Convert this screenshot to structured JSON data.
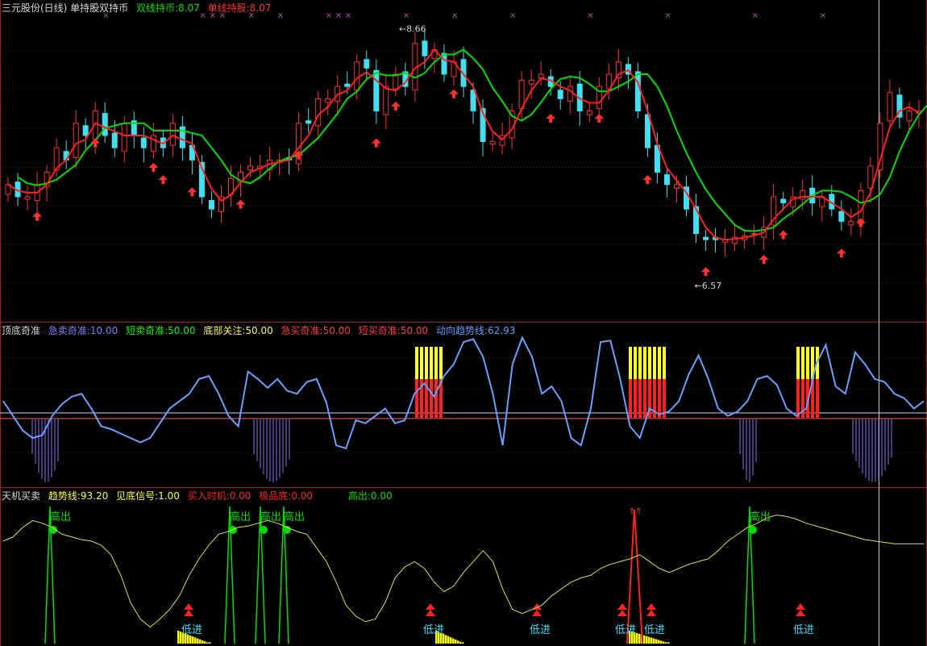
{
  "panels": {
    "top": {
      "title": "三元股份(日线) 单持股双持币",
      "legend": [
        {
          "label": "双线持币:8.07",
          "color": "#00e000"
        },
        {
          "label": "单线持股:8.07",
          "color": "#ff2020"
        }
      ],
      "high_label": "8.66",
      "low_label": "6.57"
    },
    "mid": {
      "title": "顶底奇准",
      "legend": [
        {
          "label": "急卖奇准:10.00",
          "color": "#8080ff"
        },
        {
          "label": "短卖奇准:50.00",
          "color": "#00ff00"
        },
        {
          "label": "底部关注:50.00",
          "color": "#ffff00"
        },
        {
          "label": "急买奇准:50.00",
          "color": "#ff4040"
        },
        {
          "label": "短买奇准:50.00",
          "color": "#ff4040"
        },
        {
          "label": "动向趋势线:62.93",
          "color": "#60a0ff"
        }
      ]
    },
    "bottom": {
      "title": "天机买卖",
      "legend": [
        {
          "label": "趋势线:93.20",
          "color": "#ffff00"
        },
        {
          "label": "见底信号:1.00",
          "color": "#ffff00"
        },
        {
          "label": "买入时机:0.00",
          "color": "#ff2020"
        },
        {
          "label": "极品底:0.00",
          "color": "#ff2020"
        },
        {
          "label": "高出:0.00",
          "color": "#00e000"
        }
      ],
      "buy_text": "低进",
      "sell_text": "高出"
    }
  },
  "chart_data": [
    {
      "type": "candlestick",
      "title": "三元股份(日线)",
      "close": [
        7.4,
        7.3,
        7.3,
        7.4,
        7.5,
        7.7,
        7.6,
        7.9,
        7.8,
        8.0,
        7.8,
        7.7,
        7.9,
        7.8,
        7.7,
        7.8,
        7.7,
        7.9,
        7.7,
        7.6,
        7.3,
        7.2,
        7.3,
        7.45,
        7.5,
        7.55,
        7.55,
        7.6,
        7.6,
        7.6,
        7.9,
        7.9,
        8.1,
        8.1,
        8.2,
        8.2,
        8.4,
        8.35,
        8.0,
        8.2,
        8.3,
        8.2,
        8.55,
        8.45,
        8.5,
        8.3,
        8.4,
        8.2,
        8.0,
        7.75,
        7.75,
        7.8,
        8.0,
        8.25,
        8.25,
        8.3,
        8.2,
        8.1,
        8.2,
        8.0,
        8.0,
        8.2,
        8.3,
        8.4,
        8.3,
        8.0,
        7.7,
        7.5,
        7.4,
        7.4,
        7.2,
        7.0,
        6.95,
        6.95,
        6.95,
        6.97,
        6.98,
        7.0,
        7.05,
        7.3,
        7.25,
        7.3,
        7.35,
        7.25,
        7.3,
        7.2,
        7.1,
        7.1,
        7.35,
        7.55,
        7.9,
        8.15,
        7.95,
        8.0,
        8.0
      ],
      "ylim": [
        6.3,
        8.8
      ]
    },
    {
      "type": "line",
      "series": [
        {
          "name": "动向趋势线",
          "values": [
            55,
            45,
            35,
            30,
            32,
            45,
            53,
            58,
            60,
            50,
            38,
            36,
            33,
            30,
            27,
            30,
            40,
            50,
            55,
            60,
            70,
            72,
            60,
            45,
            38,
            75,
            70,
            64,
            70,
            62,
            60,
            68,
            70,
            54,
            25,
            23,
            42,
            40,
            45,
            50,
            40,
            42,
            60,
            67,
            58,
            72,
            80,
            95,
            97,
            85,
            60,
            25,
            80,
            98,
            85,
            60,
            65,
            55,
            30,
            25,
            50,
            95,
            96,
            70,
            38,
            30,
            50,
            46,
            48,
            55,
            73,
            86,
            70,
            50,
            45,
            48,
            55,
            70,
            72,
            66,
            50,
            45,
            50,
            80,
            93,
            65,
            60,
            88,
            80,
            70,
            68,
            60,
            57,
            50,
            55
          ]
        }
      ],
      "ylim": [
        0,
        100
      ]
    },
    {
      "type": "line",
      "series": [
        {
          "name": "趋势线",
          "values": [
            75,
            78,
            85,
            90,
            88,
            85,
            80,
            78,
            76,
            75,
            72,
            65,
            50,
            30,
            18,
            12,
            18,
            25,
            35,
            50,
            62,
            72,
            80,
            82,
            85,
            86,
            88,
            90,
            88,
            85,
            82,
            80,
            70,
            60,
            45,
            28,
            20,
            16,
            18,
            30,
            48,
            56,
            60,
            55,
            45,
            38,
            42,
            52,
            60,
            68,
            60,
            40,
            25,
            22,
            25,
            28,
            35,
            40,
            45,
            48,
            50,
            55,
            58,
            60,
            62,
            65,
            60,
            55,
            52,
            55,
            58,
            60,
            62,
            68,
            75,
            80,
            85,
            88,
            92,
            94,
            93,
            91,
            88,
            86,
            84,
            82,
            80,
            78,
            76,
            75,
            74,
            73,
            73,
            73,
            73
          ]
        }
      ],
      "ylim": [
        0,
        105
      ]
    }
  ]
}
